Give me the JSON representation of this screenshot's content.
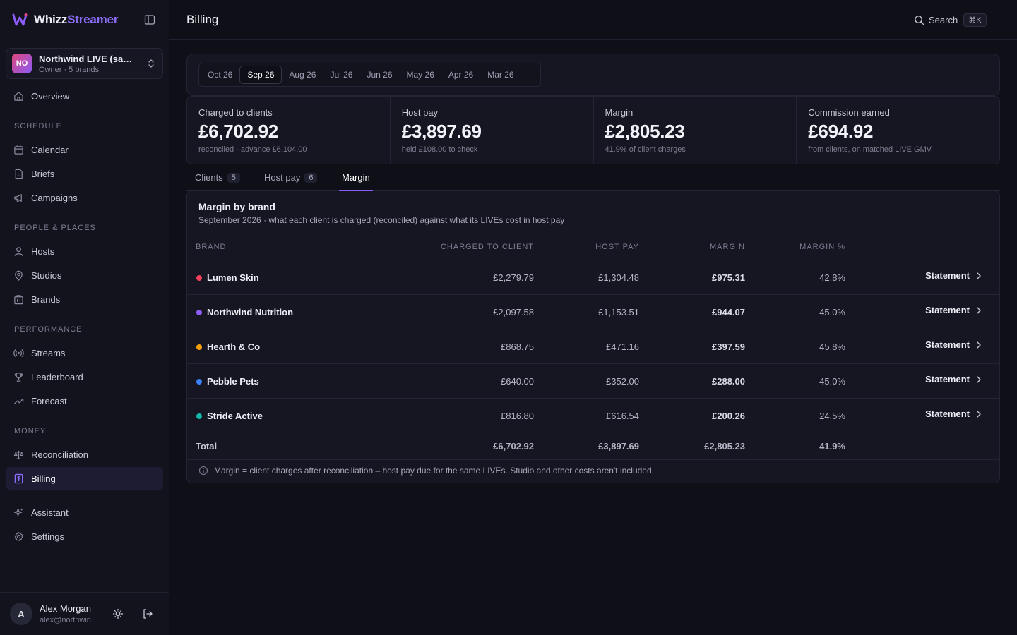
{
  "app": {
    "name_part1": "Whizz",
    "name_part2": "Streamer",
    "colors": {
      "accent": "#8b5cf6",
      "background": "#0e0f17",
      "sidebar": "#12131c"
    }
  },
  "org": {
    "initials": "NO",
    "name": "Northwind LIVE (sa…",
    "sub": "Owner · 5 brands"
  },
  "nav": {
    "overview": "Overview",
    "sections": {
      "schedule": "SCHEDULE",
      "people": "PEOPLE & PLACES",
      "performance": "PERFORMANCE",
      "money": "MONEY"
    },
    "calendar": "Calendar",
    "briefs": "Briefs",
    "campaigns": "Campaigns",
    "hosts": "Hosts",
    "studios": "Studios",
    "brands": "Brands",
    "streams": "Streams",
    "leaderboard": "Leaderboard",
    "forecast": "Forecast",
    "reconciliation": "Reconciliation",
    "billing": "Billing",
    "assistant": "Assistant",
    "settings": "Settings"
  },
  "user": {
    "initial": "A",
    "name": "Alex Morgan",
    "email": "alex@northwind…"
  },
  "header": {
    "title": "Billing",
    "search_label": "Search",
    "shortcut": "⌘K"
  },
  "months": [
    "Oct 26",
    "Sep 26",
    "Aug 26",
    "Jul 26",
    "Jun 26",
    "May 26",
    "Apr 26",
    "Mar 26"
  ],
  "selected_month": "Sep 26",
  "stats": [
    {
      "label": "Charged to clients",
      "value": "£6,702.92",
      "sub": "reconciled · advance £6,104.00"
    },
    {
      "label": "Host pay",
      "value": "£3,897.69",
      "sub": "held £108.00 to check"
    },
    {
      "label": "Margin",
      "value": "£2,805.23",
      "sub": "41.9% of client charges"
    },
    {
      "label": "Commission earned",
      "value": "£694.92",
      "sub": "from clients, on matched LIVE GMV"
    }
  ],
  "section_tabs": {
    "clients": {
      "label": "Clients",
      "count": "5"
    },
    "host_pay": {
      "label": "Host pay",
      "count": "6"
    },
    "margin": {
      "label": "Margin"
    }
  },
  "margin_table": {
    "title": "Margin by brand",
    "subtitle": "September 2026 · what each client is charged (reconciled) against what its LIVEs cost in host pay",
    "columns": {
      "brand": "BRAND",
      "charged": "CHARGED TO CLIENT",
      "host_pay": "HOST PAY",
      "margin": "MARGIN",
      "margin_pct": "MARGIN %"
    },
    "action_label": "Statement",
    "rows": [
      {
        "brand": "Lumen Skin",
        "dot_color": "#f43f5e",
        "charged": "£2,279.79",
        "host_pay": "£1,304.48",
        "margin": "£975.31",
        "margin_pct": "42.8%"
      },
      {
        "brand": "Northwind Nutrition",
        "dot_color": "#8b5cf6",
        "charged": "£2,097.58",
        "host_pay": "£1,153.51",
        "margin": "£944.07",
        "margin_pct": "45.0%"
      },
      {
        "brand": "Hearth & Co",
        "dot_color": "#f59e0b",
        "charged": "£868.75",
        "host_pay": "£471.16",
        "margin": "£397.59",
        "margin_pct": "45.8%"
      },
      {
        "brand": "Pebble Pets",
        "dot_color": "#3b82f6",
        "charged": "£640.00",
        "host_pay": "£352.00",
        "margin": "£288.00",
        "margin_pct": "45.0%"
      },
      {
        "brand": "Stride Active",
        "dot_color": "#14b8a6",
        "charged": "£816.80",
        "host_pay": "£616.54",
        "margin": "£200.26",
        "margin_pct": "24.5%"
      }
    ],
    "total": {
      "label": "Total",
      "charged": "£6,702.92",
      "host_pay": "£3,897.69",
      "margin": "£2,805.23",
      "margin_pct": "41.9%"
    },
    "note": "Margin = client charges after reconciliation – host pay due for the same LIVEs. Studio and other costs aren't included."
  }
}
